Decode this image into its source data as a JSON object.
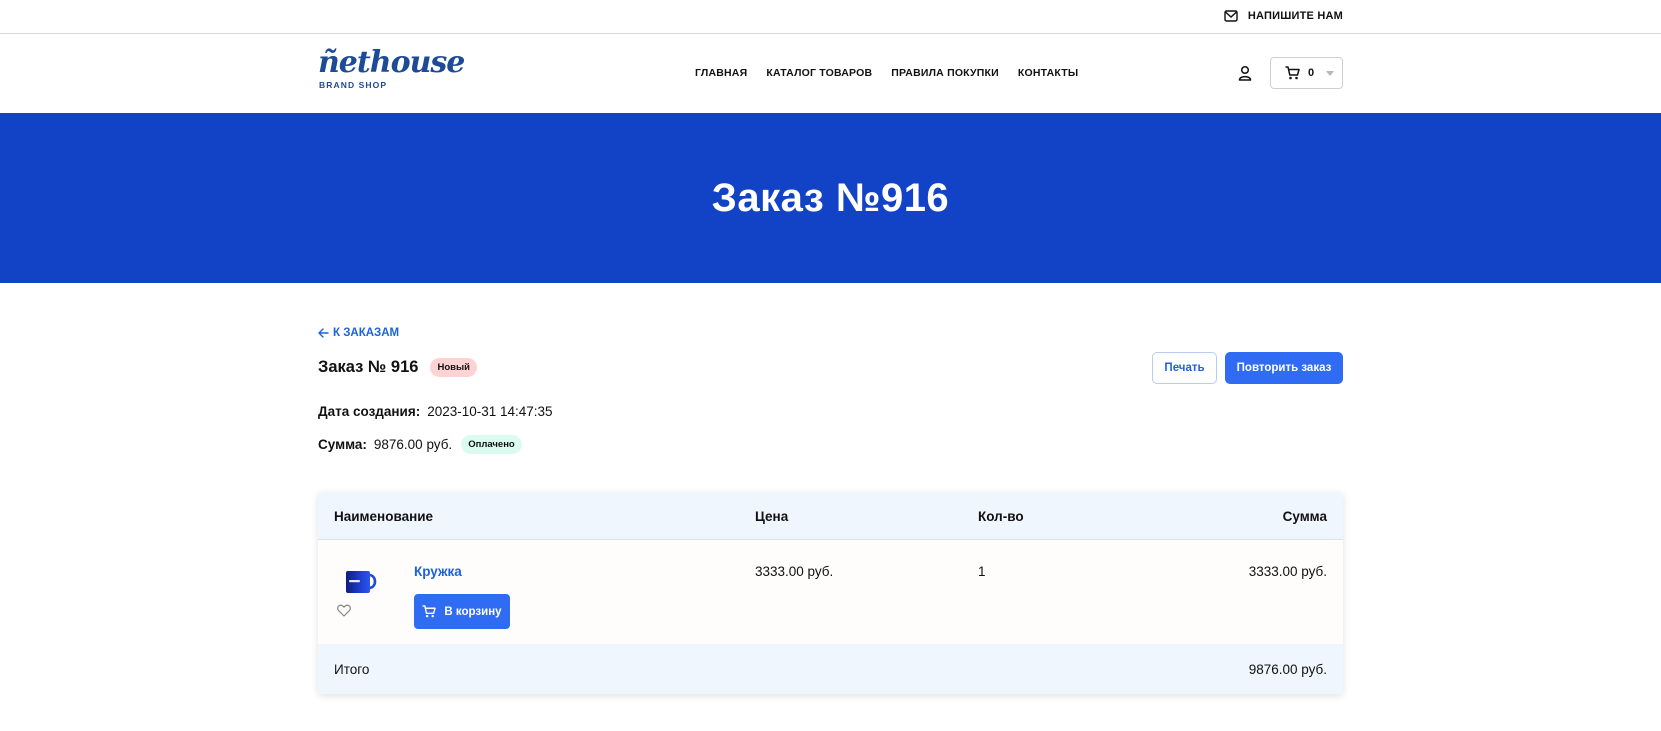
{
  "topbar": {
    "contact_label": "НАПИШИТЕ НАМ",
    "icon": "mail-icon"
  },
  "logo": {
    "main": "ñethouse",
    "sub": "BRAND SHOP"
  },
  "nav": [
    {
      "label": "ГЛАВНАЯ"
    },
    {
      "label": "КАТАЛОГ ТОВАРОВ"
    },
    {
      "label": "ПРАВИЛА ПОКУПКИ"
    },
    {
      "label": "КОНТАКТЫ"
    }
  ],
  "cart": {
    "count": "0",
    "icon": "cart-icon"
  },
  "hero": {
    "title": "Заказ №916"
  },
  "order": {
    "back_label": "К ЗАКАЗАМ",
    "title": "Заказ № 916",
    "status": "Новый",
    "date_label": "Дата создания:",
    "date_value": "2023-10-31 14:47:35",
    "sum_label": "Сумма:",
    "sum_value": "9876.00 руб.",
    "payment_status": "Оплачено",
    "print_label": "Печать",
    "repeat_label": "Повторить заказ"
  },
  "table": {
    "headers": {
      "name": "Наименование",
      "price": "Цена",
      "qty": "Кол-во",
      "sum": "Сумма"
    },
    "rows": [
      {
        "name": "Кружка",
        "price": "3333.00 руб.",
        "qty": "1",
        "sum": "3333.00 руб.",
        "cart_label": "В корзину"
      }
    ],
    "total_label": "Итого",
    "total_value": "9876.00 руб."
  },
  "colors": {
    "accent": "#1243c7",
    "button": "#2f6cf3",
    "link": "#1d63d8",
    "badge_new": "#ffd3d3",
    "badge_paid": "#dcfbf0",
    "table_head": "#f0f6fe"
  }
}
